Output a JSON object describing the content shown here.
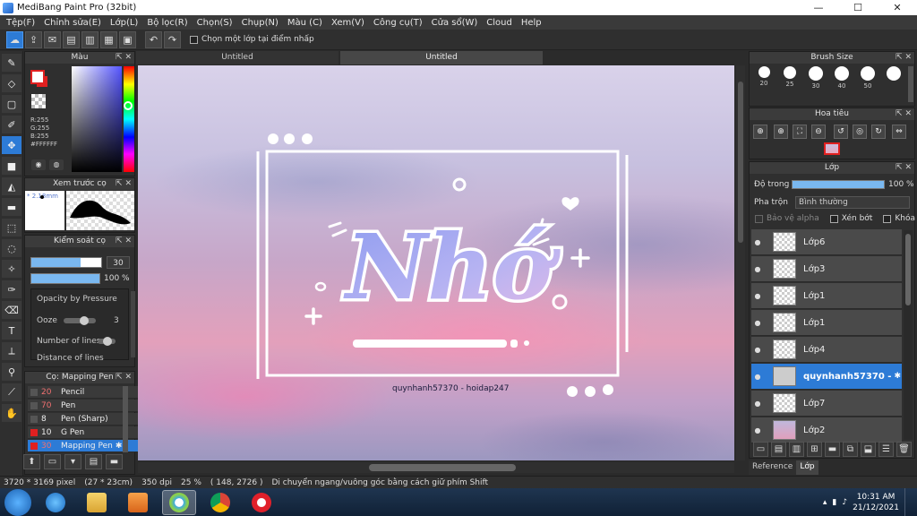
{
  "window": {
    "title": "MediBang Paint Pro (32bit)",
    "minimize": "—",
    "maximize": "☐",
    "close": "✕"
  },
  "menu": [
    "Tệp(F)",
    "Chỉnh sửa(E)",
    "Lớp(L)",
    "Bộ lọc(R)",
    "Chọn(S)",
    "Chụp(N)",
    "Màu (C)",
    "Xem(V)",
    "Công cụ(T)",
    "Cửa sổ(W)",
    "Cloud",
    "Help"
  ],
  "toolbar": {
    "option_label": "Chọn một lớp tại điểm nhấp"
  },
  "tabs": [
    "Untitled",
    "Untitled"
  ],
  "color_panel": {
    "title": "Màu",
    "r": "R:255",
    "g": "G:255",
    "b": "B:255",
    "hex": "#FFFFFF"
  },
  "preview_panel": {
    "title": "Xem trước cọ",
    "size": "2.18mm"
  },
  "brush_control": {
    "title": "Kiểm soát cọ",
    "size_value": "30",
    "opacity_value": "100 %",
    "opacity_by_pressure": "Opacity by Pressure",
    "ooze": "Ooze",
    "ooze_value": "3",
    "number_of_lines": "Number of lines",
    "distance_of_lines": "Distance of lines",
    "size_fraction": 0.7,
    "opacity_fraction": 1.0
  },
  "brush_list": {
    "title": "Cọ: Mapping Pen",
    "items": [
      {
        "size": "20",
        "name": "Pencil"
      },
      {
        "size": "70",
        "name": "Pen"
      },
      {
        "size": "8",
        "name": "Pen (Sharp)"
      },
      {
        "size": "10",
        "name": "G Pen"
      },
      {
        "size": "30",
        "name": "Mapping Pen"
      }
    ]
  },
  "brush_size": {
    "title": "Brush Size",
    "sizes": [
      "20",
      "25",
      "30",
      "40",
      "50"
    ]
  },
  "navigator": {
    "title": "Hoa tiêu"
  },
  "layer_panel": {
    "title": "Lớp",
    "opacity_label": "Độ trong",
    "opacity_value": "100 %",
    "blend_label": "Pha trộn",
    "blend_value": "Bình thường",
    "protect_alpha": "Bảo vệ alpha",
    "clipping": "Xén bớt",
    "lock": "Khóa",
    "layers": [
      "Lớp6",
      "Lớp3",
      "Lớp1",
      "Lớp1",
      "Lớp4",
      "quynhanh57370 -",
      "Lớp7",
      "Lớp2"
    ]
  },
  "right_tabs": [
    "Reference",
    "Lớp"
  ],
  "canvas": {
    "artwork_text": "Nhớ",
    "signature": "quynhanh57370 - hoidap247"
  },
  "status": {
    "dims": "3720 * 3169 pixel",
    "cm": "(27 * 23cm)",
    "dpi": "350 dpi",
    "zoom": "25 %",
    "coords": "( 148, 2726 )",
    "hint": "Di chuyển ngang/vuông góc bằng cách giữ phím Shift"
  },
  "taskbar": {
    "time": "10:31 AM",
    "date": "21/12/2021"
  }
}
